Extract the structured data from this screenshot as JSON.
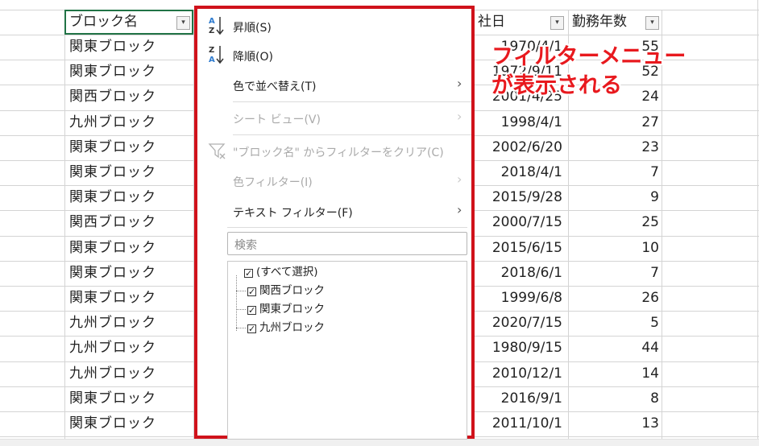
{
  "header": {
    "col_a": "ブロック名",
    "col_d": "社日",
    "col_e": "勤務年数",
    "filter_arrow": "▾"
  },
  "rows": [
    {
      "block": "関東ブロック",
      "date": "1970/4/1",
      "years": "55"
    },
    {
      "block": "関東ブロック",
      "date": "1972/9/11",
      "years": "52"
    },
    {
      "block": "関西ブロック",
      "date": "2001/4/25",
      "years": "24"
    },
    {
      "block": "九州ブロック",
      "date": "1998/4/1",
      "years": "27"
    },
    {
      "block": "関東ブロック",
      "date": "2002/6/20",
      "years": "23"
    },
    {
      "block": "関東ブロック",
      "date": "2018/4/1",
      "years": "7"
    },
    {
      "block": "関東ブロック",
      "date": "2015/9/28",
      "years": "9"
    },
    {
      "block": "関西ブロック",
      "date": "2000/7/15",
      "years": "25"
    },
    {
      "block": "関東ブロック",
      "date": "2015/6/15",
      "years": "10"
    },
    {
      "block": "関東ブロック",
      "date": "2018/6/1",
      "years": "7"
    },
    {
      "block": "関東ブロック",
      "date": "1999/6/8",
      "years": "26"
    },
    {
      "block": "九州ブロック",
      "date": "2020/7/15",
      "years": "5"
    },
    {
      "block": "九州ブロック",
      "date": "1980/9/15",
      "years": "44"
    },
    {
      "block": "九州ブロック",
      "date": "2010/12/1",
      "years": "14"
    },
    {
      "block": "関東ブロック",
      "date": "2016/9/1",
      "years": "8"
    },
    {
      "block": "関東ブロック",
      "date": "2011/10/1",
      "years": "13"
    }
  ],
  "menu": {
    "sort_asc": "昇順(S)",
    "sort_desc": "降順(O)",
    "sort_by_color": "色で並べ替え(T)",
    "sheet_view": "シート ビュー(V)",
    "clear_filter": "\"ブロック名\" からフィルターをクリア(C)",
    "color_filter": "色フィルター(I)",
    "text_filter": "テキスト フィルター(F)",
    "submenu_arrow": "›",
    "search_placeholder": "検索",
    "check_mark": "✓",
    "list": [
      "(すべて選択)",
      "関西ブロック",
      "関東ブロック",
      "九州ブロック"
    ]
  },
  "annotation": {
    "line1": "フィルターメニュー",
    "line2": "が表示される",
    "color": "#e8191e"
  },
  "colors": {
    "highlight_border": "#d0121b",
    "selected_cell_border": "#217346",
    "sort_icon_blue": "#2e7bcf"
  }
}
